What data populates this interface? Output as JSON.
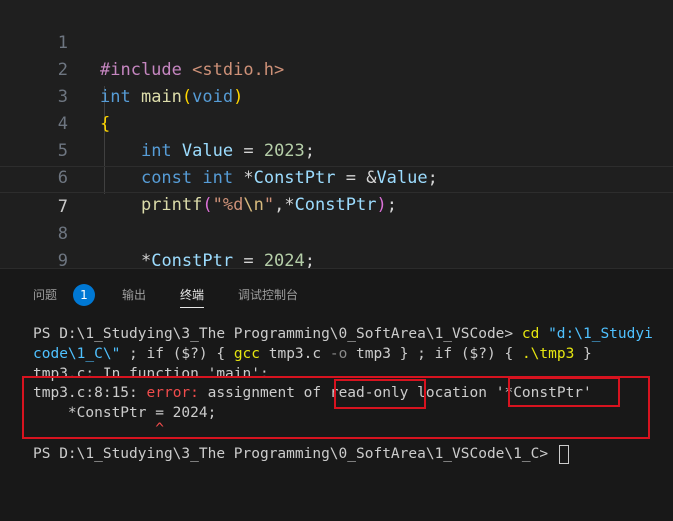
{
  "editor": {
    "lines": [
      {
        "number": "1",
        "text": "#include <stdio.h>"
      },
      {
        "number": "2",
        "text": "int main(void)"
      },
      {
        "number": "3",
        "text": "{"
      },
      {
        "number": "4",
        "text": "    int Value = 2023;"
      },
      {
        "number": "5",
        "text": "    const int *ConstPtr = &Value;"
      },
      {
        "number": "6",
        "text": "    printf(\"%d\\n\",*ConstPtr);"
      },
      {
        "number": "7",
        "text": ""
      },
      {
        "number": "8",
        "text": "    *ConstPtr = 2024;"
      },
      {
        "number": "9",
        "text": "}"
      }
    ],
    "current_line": "7",
    "tokens": {
      "include": "#include",
      "header": "<stdio.h>",
      "int": "int",
      "main": "main",
      "void": "void",
      "value": "Value",
      "num2023": "2023",
      "const": "const",
      "constptr": "ConstPtr",
      "printf": "printf",
      "fmt_a": "\"%d",
      "fmt_esc": "\\n",
      "fmt_b": "\"",
      "num2024": "2024"
    }
  },
  "panel": {
    "tabs": [
      {
        "label": "问题",
        "active": false
      },
      {
        "label": "输出",
        "active": false
      },
      {
        "label": "终端",
        "active": true
      },
      {
        "label": "调试控制台",
        "active": false
      }
    ],
    "problems_count": "1",
    "terminal": {
      "prompt1": "PS D:\\1_Studying\\3_The Programming\\0_SoftArea\\1_VSCode> ",
      "cd": "cd",
      "path1": "\"d:\\1_Studyi",
      "path2": "code\\1_C\\\"",
      "line2_rest_a": " ; if ($?) { ",
      "gcc": "gcc",
      "gcc_args_a": " tmp3.c ",
      "o_flag": "-o",
      "gcc_args_b": " tmp3 } ; if ($?) { ",
      "run": ".\\tmp3",
      "line2_end": " }",
      "line3": "tmp3.c: In function 'main':",
      "err_loc": "tmp3.c:8:15: ",
      "err_word": "error:",
      "err_msg_a": " assignment of ",
      "err_readonly": "read-only",
      "err_msg_b": " location ",
      "err_quote": "'*ConstPtr'",
      "err_src": "    *ConstPtr = 2024;",
      "err_caret": "              ^",
      "prompt2": "PS D:\\1_Studying\\3_The Programming\\0_SoftArea\\1_VSCode\\1_C> "
    }
  },
  "colors": {
    "annotation_box": "#d7131f",
    "error_text": "#f14c4c",
    "badge_bg": "#0078d4"
  }
}
